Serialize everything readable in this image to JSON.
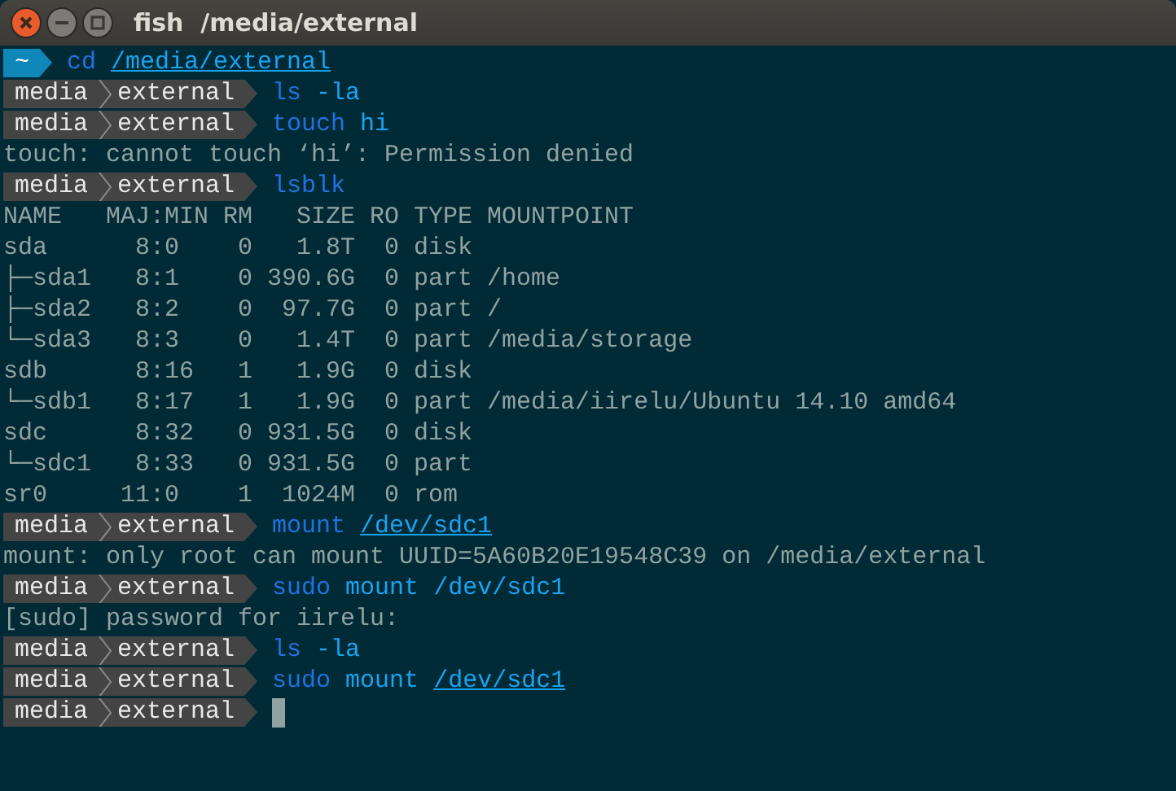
{
  "window": {
    "title": "fish  /media/external"
  },
  "lines": [
    {
      "kind": "prompt",
      "prompt": {
        "kind": "home",
        "segments": [
          "~"
        ]
      },
      "tokens": [
        {
          "text": "cd",
          "kind": "command",
          "underlined": false
        },
        {
          "text": "/media/external",
          "kind": "argument",
          "underlined": true
        }
      ]
    },
    {
      "kind": "prompt",
      "prompt": {
        "kind": "dir",
        "segments": [
          "media",
          "external"
        ]
      },
      "tokens": [
        {
          "text": "ls",
          "kind": "command",
          "underlined": false
        },
        {
          "text": "-la",
          "kind": "argument",
          "underlined": false
        }
      ]
    },
    {
      "kind": "prompt",
      "prompt": {
        "kind": "dir",
        "segments": [
          "media",
          "external"
        ]
      },
      "tokens": [
        {
          "text": "touch",
          "kind": "command",
          "underlined": false
        },
        {
          "text": "hi",
          "kind": "argument",
          "underlined": false
        }
      ]
    },
    {
      "kind": "output",
      "text": "touch: cannot touch ‘hi’: Permission denied"
    },
    {
      "kind": "prompt",
      "prompt": {
        "kind": "dir",
        "segments": [
          "media",
          "external"
        ]
      },
      "tokens": [
        {
          "text": "lsblk",
          "kind": "command",
          "underlined": false
        }
      ]
    },
    {
      "kind": "output",
      "text": "NAME   MAJ:MIN RM   SIZE RO TYPE MOUNTPOINT"
    },
    {
      "kind": "output",
      "text": "sda      8:0    0   1.8T  0 disk"
    },
    {
      "kind": "output",
      "text": "├─sda1   8:1    0 390.6G  0 part /home"
    },
    {
      "kind": "output",
      "text": "├─sda2   8:2    0  97.7G  0 part /"
    },
    {
      "kind": "output",
      "text": "└─sda3   8:3    0   1.4T  0 part /media/storage"
    },
    {
      "kind": "output",
      "text": "sdb      8:16   1   1.9G  0 disk"
    },
    {
      "kind": "output",
      "text": "└─sdb1   8:17   1   1.9G  0 part /media/iirelu/Ubuntu 14.10 amd64"
    },
    {
      "kind": "output",
      "text": "sdc      8:32   0 931.5G  0 disk"
    },
    {
      "kind": "output",
      "text": "└─sdc1   8:33   0 931.5G  0 part"
    },
    {
      "kind": "output",
      "text": "sr0     11:0    1  1024M  0 rom"
    },
    {
      "kind": "prompt",
      "prompt": {
        "kind": "dir",
        "segments": [
          "media",
          "external"
        ]
      },
      "tokens": [
        {
          "text": "mount",
          "kind": "command",
          "underlined": false
        },
        {
          "text": "/dev/sdc1",
          "kind": "argument",
          "underlined": true
        }
      ]
    },
    {
      "kind": "output",
      "text": "mount: only root can mount UUID=5A60B20E19548C39 on /media/external"
    },
    {
      "kind": "prompt",
      "prompt": {
        "kind": "dir",
        "segments": [
          "media",
          "external"
        ]
      },
      "tokens": [
        {
          "text": "sudo",
          "kind": "command",
          "underlined": false
        },
        {
          "text": "mount",
          "kind": "argument",
          "underlined": false
        },
        {
          "text": "/dev/sdc1",
          "kind": "argument",
          "underlined": false
        }
      ]
    },
    {
      "kind": "output",
      "text": "[sudo] password for iirelu:"
    },
    {
      "kind": "prompt",
      "prompt": {
        "kind": "dir",
        "segments": [
          "media",
          "external"
        ]
      },
      "tokens": [
        {
          "text": "ls",
          "kind": "command",
          "underlined": false
        },
        {
          "text": "-la",
          "kind": "argument",
          "underlined": false
        }
      ]
    },
    {
      "kind": "prompt",
      "prompt": {
        "kind": "dir",
        "segments": [
          "media",
          "external"
        ]
      },
      "tokens": [
        {
          "text": "sudo",
          "kind": "command",
          "underlined": false
        },
        {
          "text": "mount",
          "kind": "argument",
          "underlined": false
        },
        {
          "text": "/dev/sdc1",
          "kind": "argument",
          "underlined": true
        }
      ]
    },
    {
      "kind": "prompt",
      "prompt": {
        "kind": "dir",
        "segments": [
          "media",
          "external"
        ]
      },
      "cursor": true
    }
  ]
}
